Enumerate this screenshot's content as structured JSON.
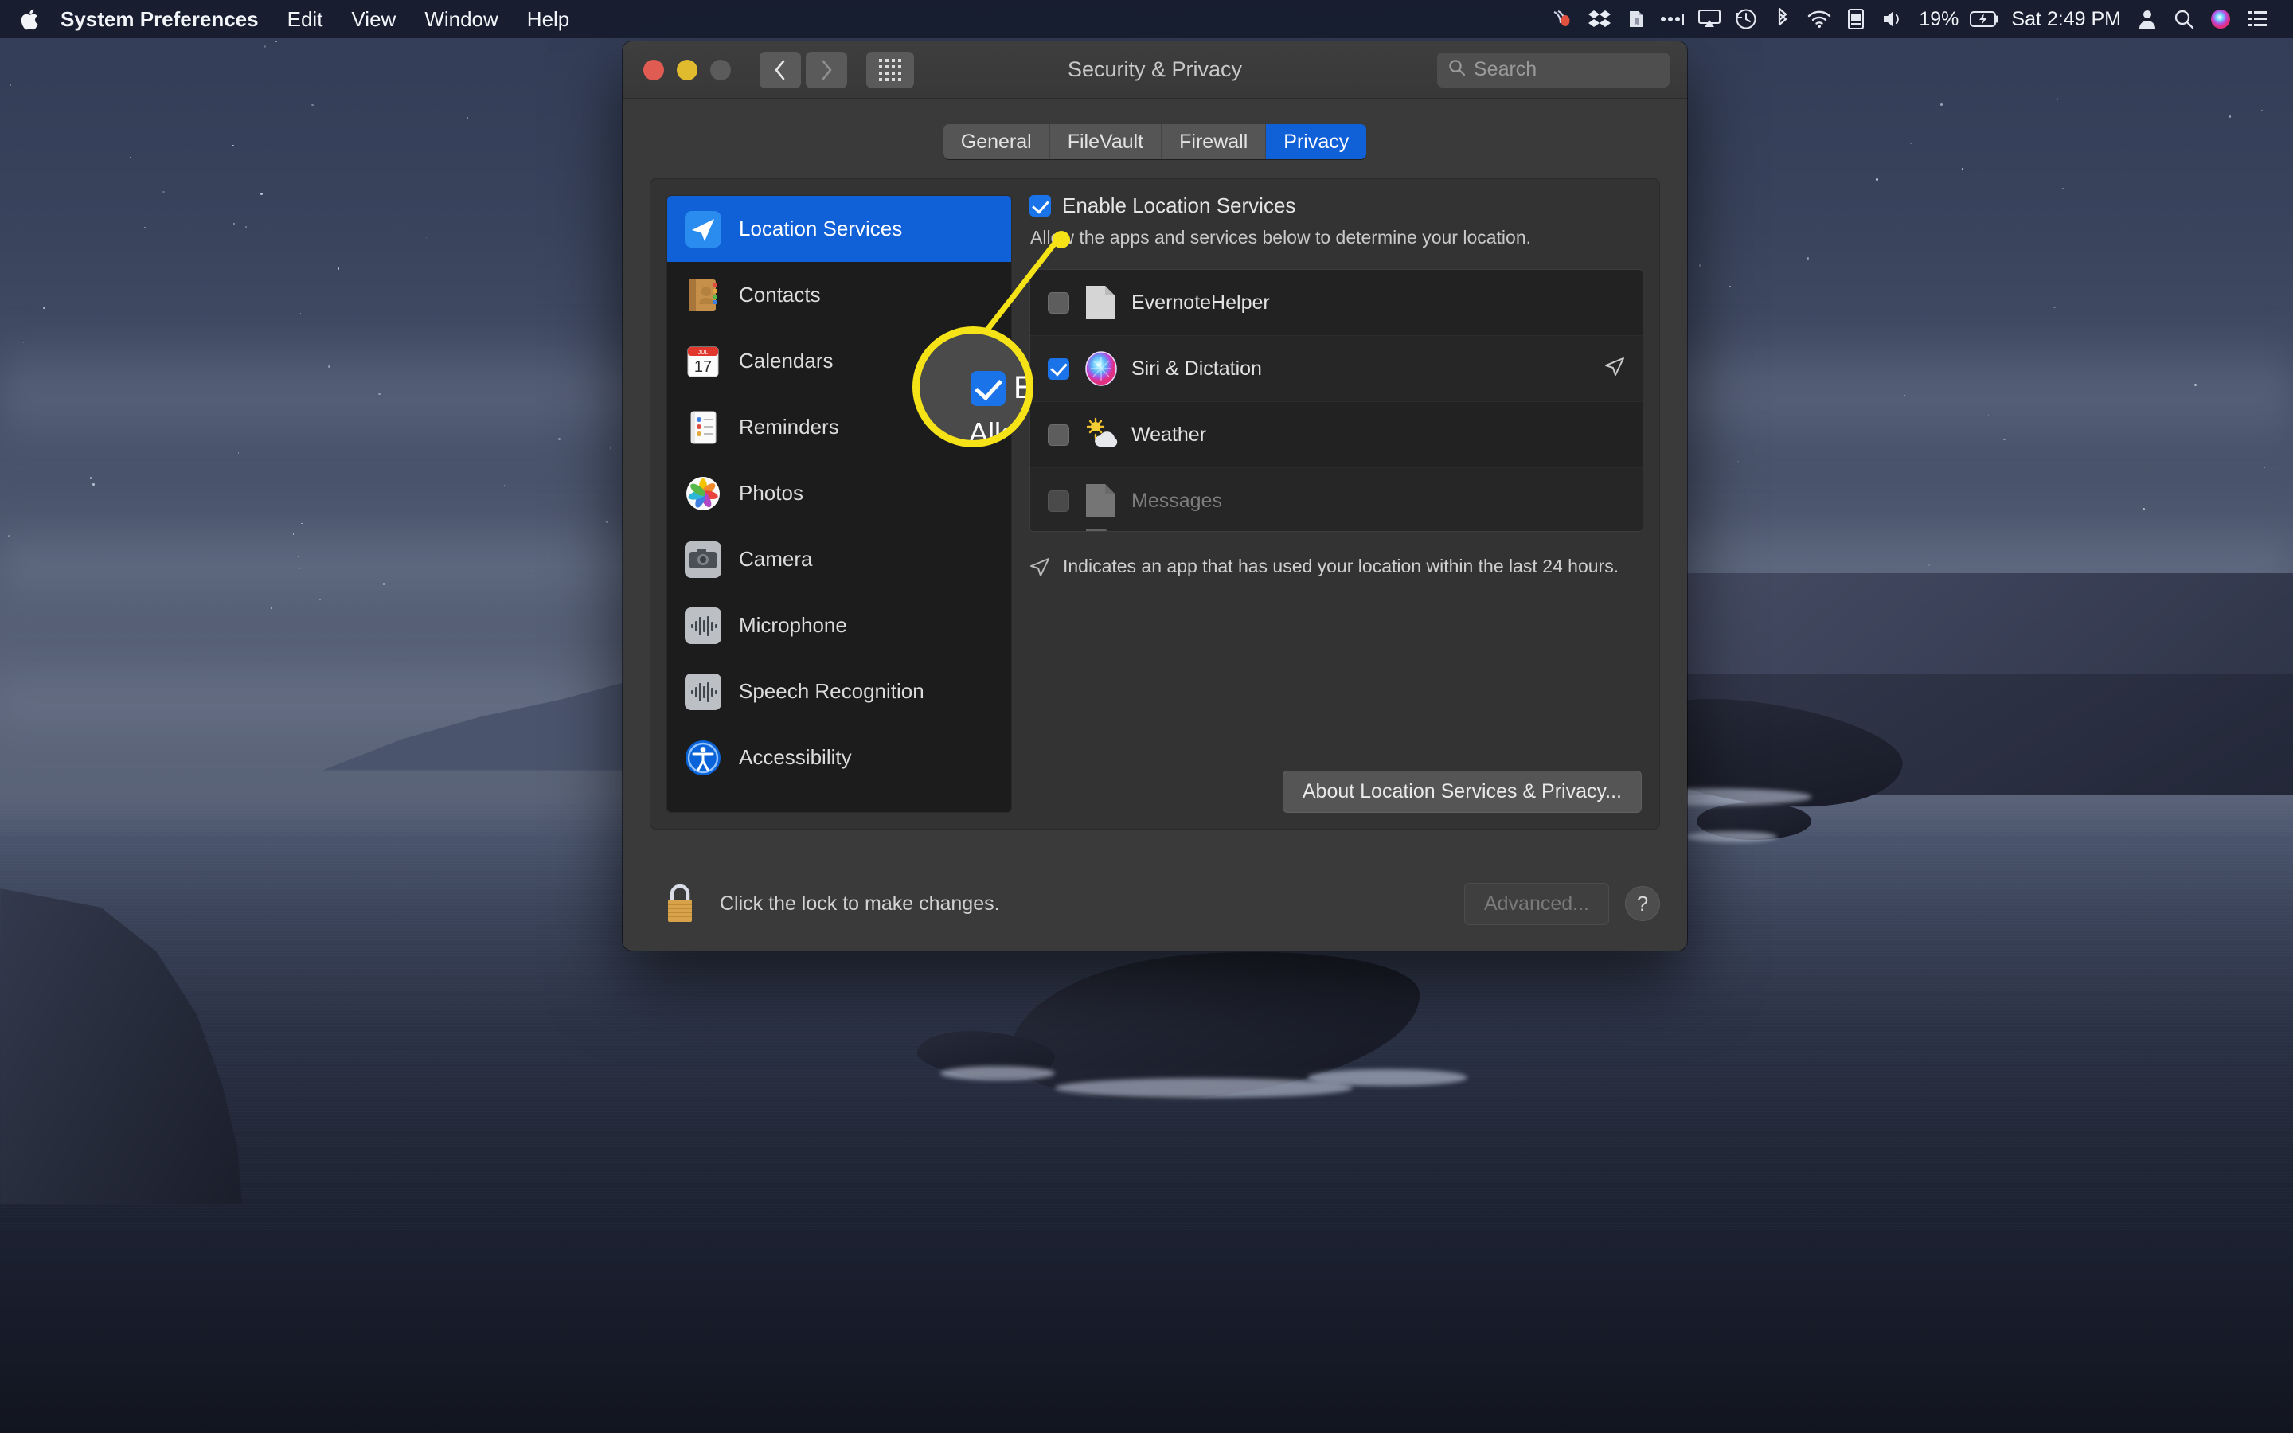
{
  "menubar": {
    "apple_icon": "apple-logo",
    "items": [
      {
        "label": "System Preferences",
        "bold": true
      },
      {
        "label": "Edit",
        "bold": false
      },
      {
        "label": "View",
        "bold": false
      },
      {
        "label": "Window",
        "bold": false
      },
      {
        "label": "Help",
        "bold": false
      }
    ],
    "status_icons": [
      "crashplan-icon",
      "dropbox-icon",
      "evernote-icon",
      "ellipsis-icon",
      "airplay-icon",
      "timemachine-icon",
      "bluetooth-icon",
      "wifi-icon",
      "keyboard-input-icon",
      "volume-icon"
    ],
    "battery_percent": "19%",
    "battery_icon": "battery-charging-icon",
    "clock": "Sat 2:49 PM",
    "right_icons": [
      "user-account-icon",
      "spotlight-search-icon",
      "siri-icon",
      "control-center-icon"
    ]
  },
  "window": {
    "title": "Security & Privacy",
    "traffic_lights": [
      "close",
      "minimize",
      "zoom-disabled"
    ],
    "nav": {
      "back_icon": "chevron-left-icon",
      "forward_icon": "chevron-right-icon",
      "grid_icon": "show-all-grid-icon"
    },
    "search": {
      "placeholder": "Search",
      "icon": "search-icon",
      "value": ""
    }
  },
  "tabs": [
    {
      "label": "General",
      "active": false
    },
    {
      "label": "FileVault",
      "active": false
    },
    {
      "label": "Firewall",
      "active": false
    },
    {
      "label": "Privacy",
      "active": true
    }
  ],
  "sidebar": {
    "items": [
      {
        "label": "Location Services",
        "icon": "location-arrow-icon",
        "selected": true
      },
      {
        "label": "Contacts",
        "icon": "contacts-book-icon",
        "selected": false
      },
      {
        "label": "Calendars",
        "icon": "calendar-icon",
        "selected": false
      },
      {
        "label": "Reminders",
        "icon": "reminders-list-icon",
        "selected": false
      },
      {
        "label": "Photos",
        "icon": "photos-pinwheel-icon",
        "selected": false
      },
      {
        "label": "Camera",
        "icon": "camera-icon",
        "selected": false
      },
      {
        "label": "Microphone",
        "icon": "microphone-waveform-icon",
        "selected": false
      },
      {
        "label": "Speech Recognition",
        "icon": "speech-waveform-icon",
        "selected": false
      },
      {
        "label": "Accessibility",
        "icon": "accessibility-icon",
        "selected": false
      }
    ]
  },
  "main": {
    "enable_checkbox": {
      "label": "Enable Location Services",
      "checked": true
    },
    "description": "Allow the apps and services below to determine your location.",
    "apps": [
      {
        "name": "EvernoteHelper",
        "checked": false,
        "disabled": false,
        "recent_use": false,
        "icon": "generic-document-icon"
      },
      {
        "name": "Siri & Dictation",
        "checked": true,
        "disabled": false,
        "recent_use": true,
        "icon": "siri-orb-icon"
      },
      {
        "name": "Weather",
        "checked": false,
        "disabled": false,
        "recent_use": false,
        "icon": "weather-sun-cloud-icon"
      },
      {
        "name": "Messages",
        "checked": false,
        "disabled": true,
        "recent_use": false,
        "icon": "generic-document-icon"
      }
    ],
    "legend": {
      "icon": "location-arrow-indicator",
      "text": "Indicates an app that has used your location within the last 24 hours."
    },
    "about_button": "About Location Services & Privacy..."
  },
  "footer": {
    "lock_icon": "padlock-closed-icon",
    "lock_message": "Click the lock to make changes.",
    "advanced_button": "Advanced...",
    "help_button": "?"
  },
  "callout": {
    "zoom_checkbox_checked": true,
    "zoom_text_top": "En",
    "zoom_text_bottom": "Allo",
    "highlight_color": "#f5e317"
  },
  "colors": {
    "accent_blue": "#1060d8",
    "checkbox_blue": "#1a73e8",
    "callout_yellow": "#f5e317",
    "window_bg": "#3a3a3a",
    "sidebar_bg": "#1c1c1c"
  }
}
